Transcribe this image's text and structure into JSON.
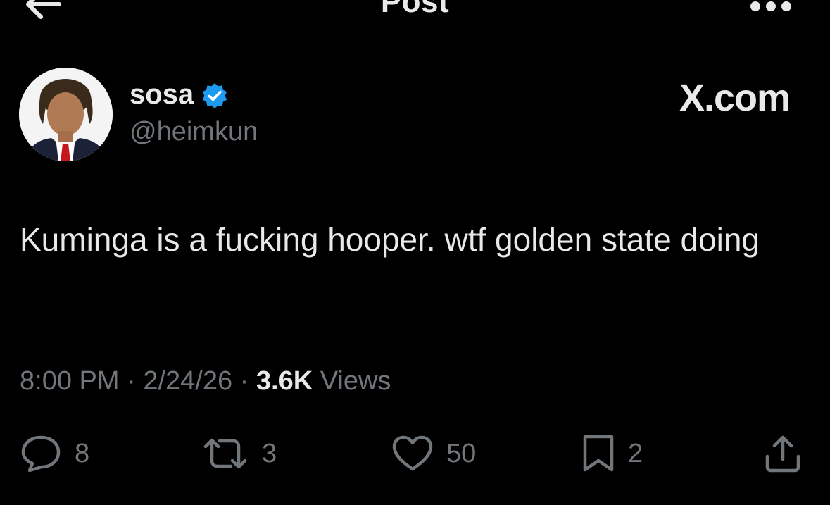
{
  "header": {
    "title": "Post",
    "back_icon": "arrow-left-icon",
    "more_icon": "more-horizontal-icon"
  },
  "author": {
    "display_name": "sosa",
    "handle": "@heimkun",
    "verified": true,
    "verified_color": "#1d9bf0"
  },
  "source_label": "X.com",
  "post": {
    "text": "Kuminga is a fucking hooper. wtf golden state doing"
  },
  "meta": {
    "time": "8:00 PM",
    "separator": "·",
    "date": "2/24/26",
    "views_count": "3.6K",
    "views_label": "Views"
  },
  "actions": {
    "replies": "8",
    "reposts": "3",
    "likes": "50",
    "bookmarks": "2"
  },
  "colors": {
    "background": "#000000",
    "primary_text": "#e7e9ea",
    "secondary_text": "#71767b"
  }
}
